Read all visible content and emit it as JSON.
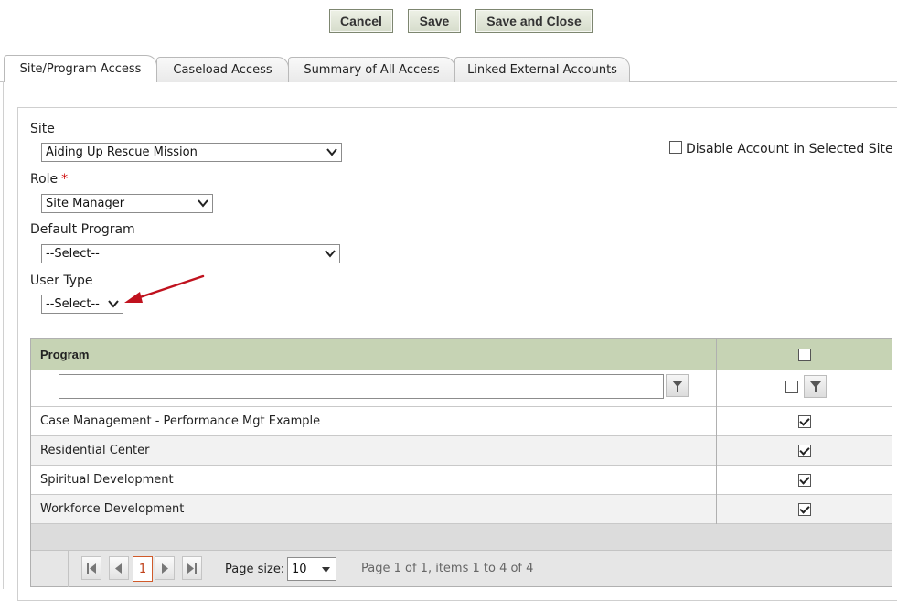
{
  "toolbar": {
    "cancel_label": "Cancel",
    "save_label": "Save",
    "save_close_label": "Save and Close"
  },
  "tabs": [
    {
      "label": "Site/Program Access",
      "active": true
    },
    {
      "label": "Caseload Access",
      "active": false
    },
    {
      "label": "Summary of All Access",
      "active": false
    },
    {
      "label": "Linked External Accounts",
      "active": false
    }
  ],
  "form": {
    "site": {
      "label": "Site",
      "value": "Aiding Up Rescue Mission"
    },
    "disable_account": {
      "label": "Disable Account in Selected Site",
      "checked": false
    },
    "role": {
      "label": "Role",
      "required_marker": "*",
      "value": "Site Manager"
    },
    "default_program": {
      "label": "Default Program",
      "value": "--Select--"
    },
    "user_type": {
      "label": "User Type",
      "value": "--Select--"
    }
  },
  "grid": {
    "column_program": "Program",
    "filter_value": "",
    "rows": [
      {
        "program": "Case Management - Performance Mgt Example",
        "checked": true
      },
      {
        "program": "Residential Center",
        "checked": true
      },
      {
        "program": "Spiritual Development",
        "checked": true
      },
      {
        "program": "Workforce Development",
        "checked": true
      }
    ]
  },
  "pager": {
    "current_page": "1",
    "page_size_label": "Page size:",
    "page_size_value": "10",
    "info": "Page 1 of 1, items 1 to 4 of 4"
  },
  "colors": {
    "header_bg": "#c6d3b4",
    "button_border": "#7d8670",
    "required": "#cc0000",
    "arrow": "#c0121e",
    "page_active": "#d05a2a"
  }
}
